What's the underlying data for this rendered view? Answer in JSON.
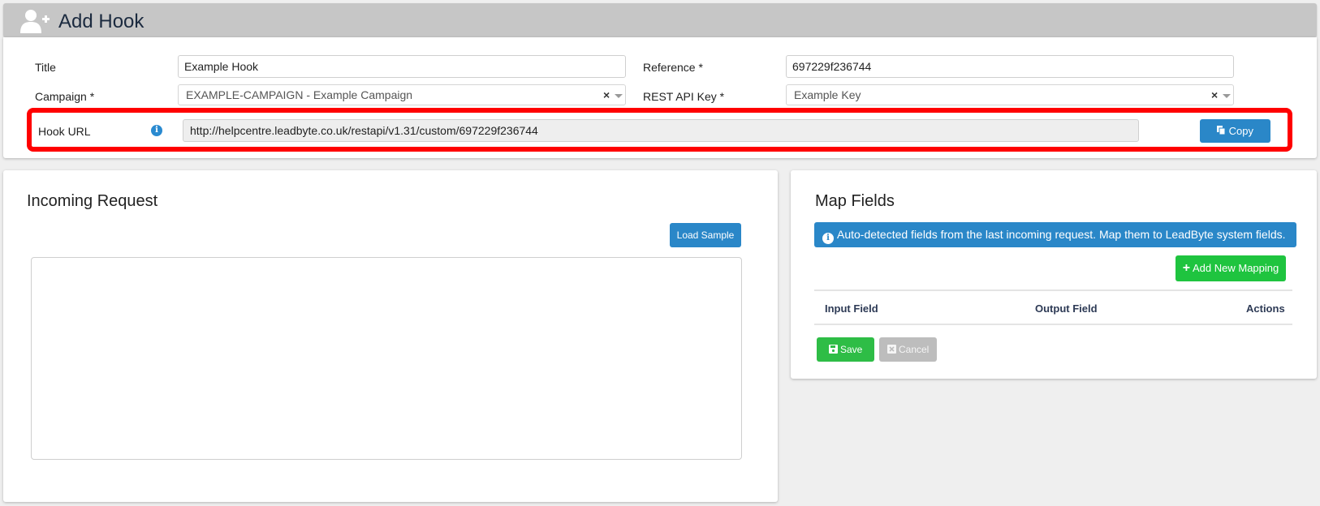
{
  "header": {
    "title": "Add Hook",
    "icon": "user-plus-icon"
  },
  "form": {
    "title_label": "Title",
    "title_value": "Example Hook",
    "reference_label": "Reference *",
    "reference_value": "697229f236744",
    "campaign_label": "Campaign *",
    "campaign_value": "EXAMPLE-CAMPAIGN - Example Campaign",
    "api_key_label": "REST API Key *",
    "api_key_value": "Example Key",
    "clear_symbol": "×",
    "hook_url_label": "Hook URL",
    "hook_url_value": "http://helpcentre.leadbyte.co.uk/restapi/v1.31/custom/697229f236744",
    "copy_label": "Copy"
  },
  "incoming": {
    "title": "Incoming Request",
    "load_sample_label": "Load Sample"
  },
  "map_fields": {
    "title": "Map Fields",
    "alert_text": "Auto-detected fields from the last incoming request. Map them to LeadByte system fields.",
    "add_mapping_label": "Add New Mapping",
    "columns": [
      "Input Field",
      "Output Field",
      "Actions"
    ],
    "save_label": "Save",
    "cancel_label": "Cancel"
  },
  "colors": {
    "accent_blue": "#2a87c8",
    "green": "#1fc43f",
    "highlight_red": "#ff0000",
    "header_gray": "#c6c6c6"
  }
}
